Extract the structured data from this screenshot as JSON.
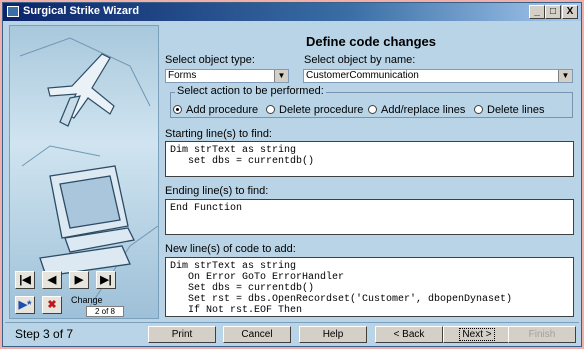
{
  "window": {
    "title": "Surgical Strike Wizard",
    "controls": [
      "_",
      "□",
      "X"
    ]
  },
  "heading": "Define code changes",
  "object_type": {
    "label": "Select object type:",
    "value": "Forms"
  },
  "object_name": {
    "label": "Select object by name:",
    "value": "CustomerCommunication"
  },
  "action": {
    "legend": "Select action to be performed:",
    "options": [
      "Add procedure",
      "Delete procedure",
      "Add/replace lines",
      "Delete lines"
    ],
    "selected": "Add procedure"
  },
  "starting": {
    "label": "Starting line(s) to find:",
    "code": "Dim strText as string\n   set dbs = currentdb()"
  },
  "ending": {
    "label": "Ending line(s) to find:",
    "code": "End Function"
  },
  "newcode": {
    "label": "New line(s) of code to add:",
    "code": "Dim strText as string\n   On Error GoTo ErrorHandler\n   Set dbs = currentdb()\n   Set rst = dbs.OpenRecordset('Customer', dbopenDynaset)\n   If Not rst.EOF Then"
  },
  "nav": {
    "first": "|◀",
    "prev": "◀",
    "next": "▶",
    "last": "▶|",
    "add": "▶*",
    "delete": "✖",
    "change_label": "Change",
    "position": "2 of 8"
  },
  "footer": {
    "step": "Step 3 of 7",
    "print": "Print",
    "cancel": "Cancel",
    "help": "Help",
    "back": "< Back",
    "next": "Next >",
    "finish": "Finish"
  }
}
